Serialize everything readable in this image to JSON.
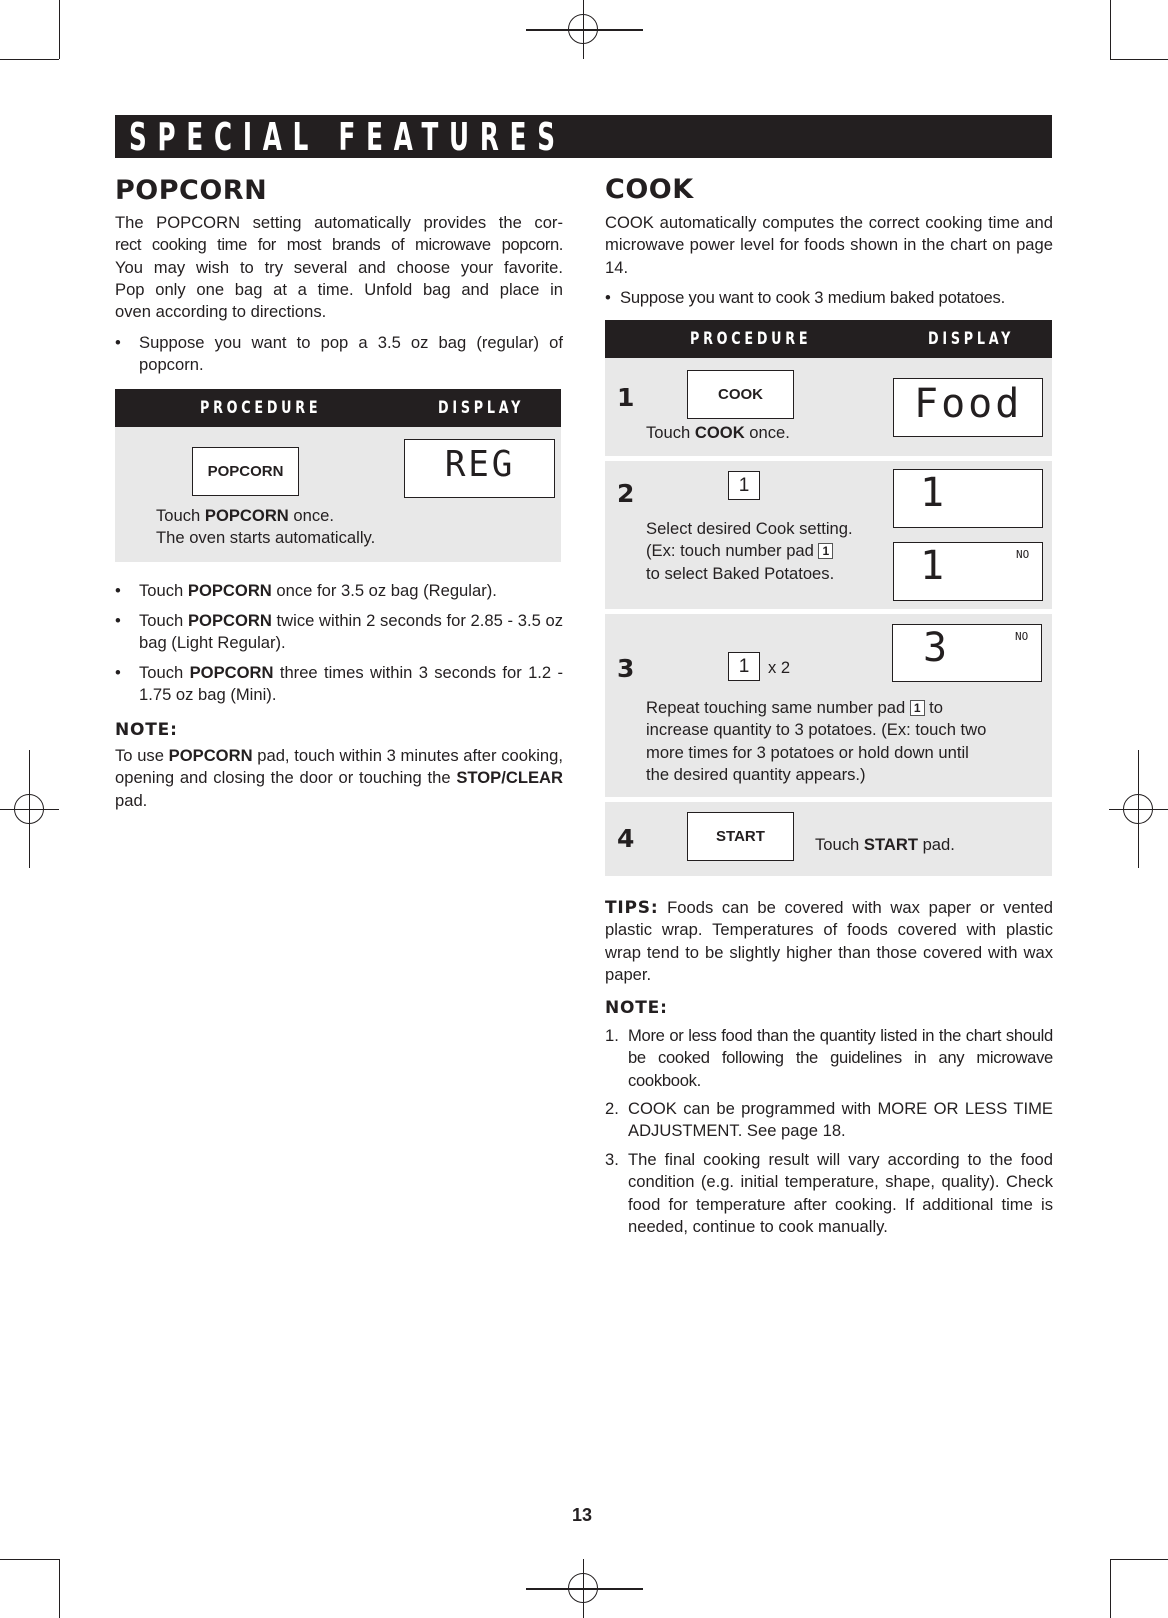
{
  "banner": {
    "title": "SPECIAL FEATURES"
  },
  "popcorn": {
    "heading": "POPCORN",
    "intro_lines": [
      "The POPCORN setting automatically provides the  cor-",
      "rect cooking time for most brands of microwave popcorn.",
      "You may wish to try several and choose your favorite.",
      "Pop only one bag at a time. Unfold bag and place in",
      "oven according to directions."
    ],
    "example": [
      "Suppose you want to pop a 3.5 oz bag (regular) of",
      "popcorn."
    ],
    "table": {
      "procedure_header": "PROCEDURE",
      "display_header": "DISPLAY",
      "pad_label": "POPCORN",
      "display_value": "REG",
      "instruction_pre": "Touch ",
      "instruction_bold": "POPCORN",
      "instruction_post": " once.",
      "instruction_line2": "The oven starts automatically."
    },
    "bullets": [
      {
        "pre": "Touch ",
        "bold": "POPCORN",
        "post": " once for 3.5 oz bag (Regular)."
      },
      {
        "pre": "Touch ",
        "bold": "POPCORN",
        "post": " twice within 2 seconds for 2.85 - 3.5 oz bag (Light Regular)."
      },
      {
        "pre": "Touch ",
        "bold": "POPCORN",
        "post": " three times within 3 seconds for 1.2 - 1.75 oz bag (Mini)."
      }
    ],
    "note": {
      "heading": "NOTE:",
      "pre": "To use ",
      "bold1": "POPCORN",
      "mid": " pad, touch within 3 minutes after cooking, opening and closing the door or touching the ",
      "bold2": "STOP/CLEAR",
      "post": " pad."
    }
  },
  "cook": {
    "heading": "COOK",
    "intro": "COOK automatically computes the correct cooking time and microwave power level for foods shown in the chart on page 14.",
    "example": "Suppose you want to cook 3 medium baked potatoes.",
    "table": {
      "procedure_header": "PROCEDURE",
      "display_header": "DISPLAY",
      "steps": [
        {
          "number": "1",
          "pad_label": "COOK",
          "text_pre": "Touch ",
          "text_bold": "COOK",
          "text_post": " once.",
          "display": "Food"
        },
        {
          "number": "2",
          "key": "1",
          "text_line1": "Select desired Cook setting.",
          "text_line2_pre": "(Ex: touch number pad ",
          "inline_key": "1",
          "text_line3": "to select Baked Potatoes.",
          "display_a": "1",
          "display_b": "1",
          "display_b_indicator": "NO"
        },
        {
          "number": "3",
          "key": "1",
          "multiplier": "x 2",
          "text_line1_pre": "Repeat touching same number pad ",
          "inline_key": "1",
          "text_line1_post": " to",
          "text_rest": [
            "increase quantity to 3 potatoes. (Ex: touch two",
            "more times for 3 potatoes or hold down until",
            "the desired quantity appears.)"
          ],
          "display": "3",
          "display_indicator": "NO"
        },
        {
          "number": "4",
          "pad_label": "START",
          "text_pre": "Touch ",
          "text_bold": "START",
          "text_post": " pad."
        }
      ]
    },
    "tips": {
      "heading": "TIPS:",
      "text": "Foods can be covered with wax paper or vented plastic wrap. Temperatures of foods covered with plastic wrap tend to be slightly higher than those covered with wax paper."
    },
    "note": {
      "heading": "NOTE:",
      "items": [
        {
          "num": "1.",
          "text": "More or less food than the quantity listed in the chart should be cooked following the guidelines in any microwave cookbook."
        },
        {
          "num": "2.",
          "text": "COOK can be programmed with MORE OR LESS TIME ADJUSTMENT. See page 18."
        },
        {
          "num": "3.",
          "text": "The final cooking result will vary according to the food condition (e.g. initial temperature, shape, quality). Check food for temperature after cooking. If additional time is needed, continue to cook manually."
        }
      ]
    }
  },
  "page_number": "13"
}
